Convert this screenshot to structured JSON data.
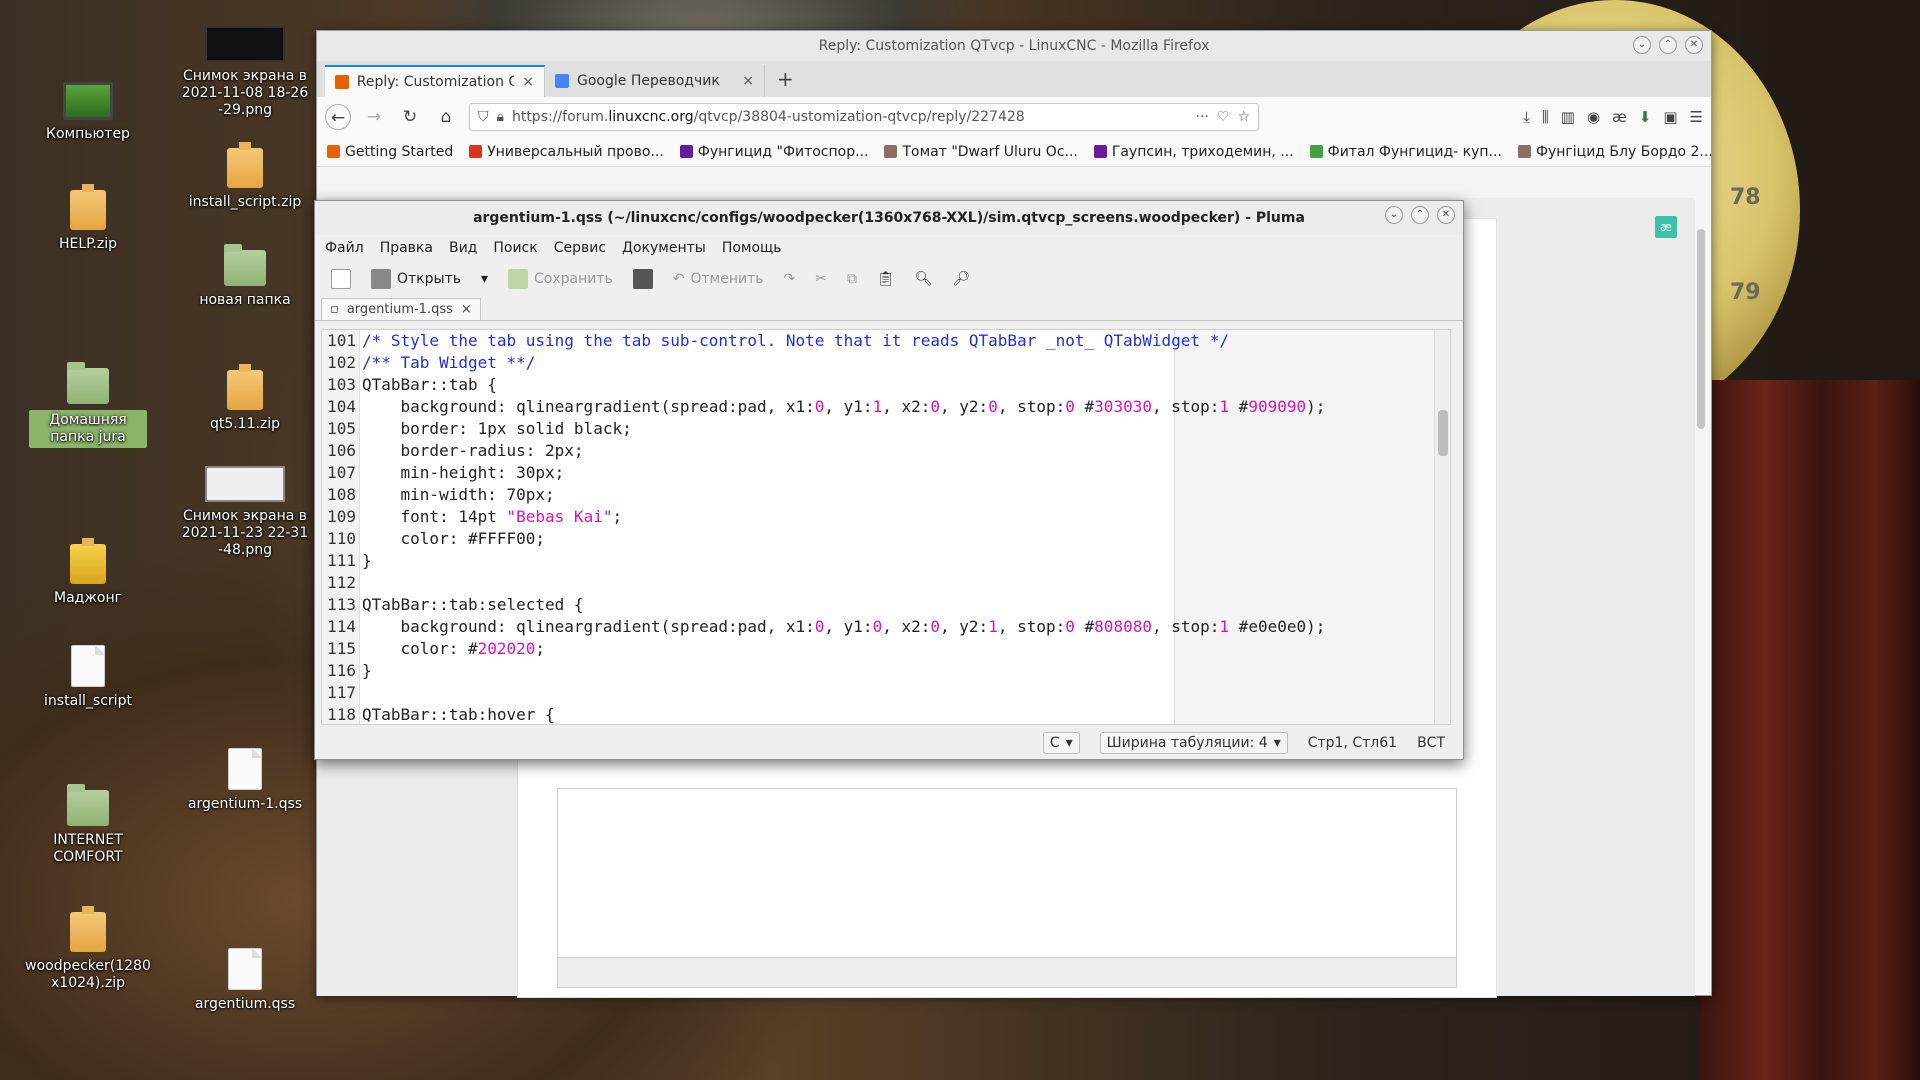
{
  "desktop": {
    "icons": [
      {
        "label": "Компьютер"
      },
      {
        "label": "HELP.zip"
      },
      {
        "label": "Домашняя папка jura"
      },
      {
        "label": "Маджонг"
      },
      {
        "label": "install_script"
      },
      {
        "label": "INTERNET COMFORT"
      },
      {
        "label": "woodpecker(1280x1024).zip"
      },
      {
        "label": "Снимок экрана в 2021-11-08 18-26-29.png"
      },
      {
        "label": "install_script.zip"
      },
      {
        "label": "новая папка"
      },
      {
        "label": "qt5.11.zip"
      },
      {
        "label": "Снимок экрана в 2021-11-23 22-31-48.png"
      },
      {
        "label": "argentium-1.qss"
      },
      {
        "label": "argentium.qss"
      }
    ],
    "coin_marks": [
      "78",
      "79"
    ]
  },
  "firefox": {
    "title": "Reply: Customization QTvcp - LinuxCNC - Mozilla Firefox",
    "tabs": [
      {
        "label": "Reply: Customization QT",
        "close": "×"
      },
      {
        "label": "Google Переводчик",
        "close": "×"
      }
    ],
    "new_tab": "+",
    "url": {
      "prefix": "https://forum.",
      "host": "linuxcnc.org",
      "path": "/qtvcp/38804-ustomization-qtvcp/reply/227428"
    },
    "url_more": "···",
    "bookmarks": [
      {
        "label": "Getting Started",
        "color": "#e66000"
      },
      {
        "label": "Универсальный прово...",
        "color": "#e0301e"
      },
      {
        "label": "Фунгицид \"Фитоспор...",
        "color": "#6a1b9a"
      },
      {
        "label": "Томат \"Dwarf Uluru Oc...",
        "color": "#8d6e63"
      },
      {
        "label": "Гаупсин, триходемин, ...",
        "color": "#6a1b9a"
      },
      {
        "label": "Фитал Фунгицид- куп...",
        "color": "#43a047"
      },
      {
        "label": "Фунгіцид Блу Бордо 2...",
        "color": "#8d6e63"
      }
    ],
    "bookmarks_overflow": "»",
    "ae_badge": "æ",
    "ext_ae": "æ"
  },
  "pluma": {
    "title": "argentium-1.qss (~/linuxcnc/configs/woodpecker(1360x768-XXL)/sim.qtvcp_screens.woodpecker) - Pluma",
    "menu": [
      "Файл",
      "Правка",
      "Вид",
      "Поиск",
      "Сервис",
      "Документы",
      "Помощь"
    ],
    "toolbar": {
      "open": "Открыть",
      "save": "Сохранить",
      "undo": "Отменить"
    },
    "doc_tab": "argentium-1.qss",
    "doc_tab_close": "×",
    "status": {
      "language": "C",
      "tab_width": "Ширина табуляции:  4",
      "position": "Стр1, Стл61",
      "mode": "ВСТ"
    }
  }
}
